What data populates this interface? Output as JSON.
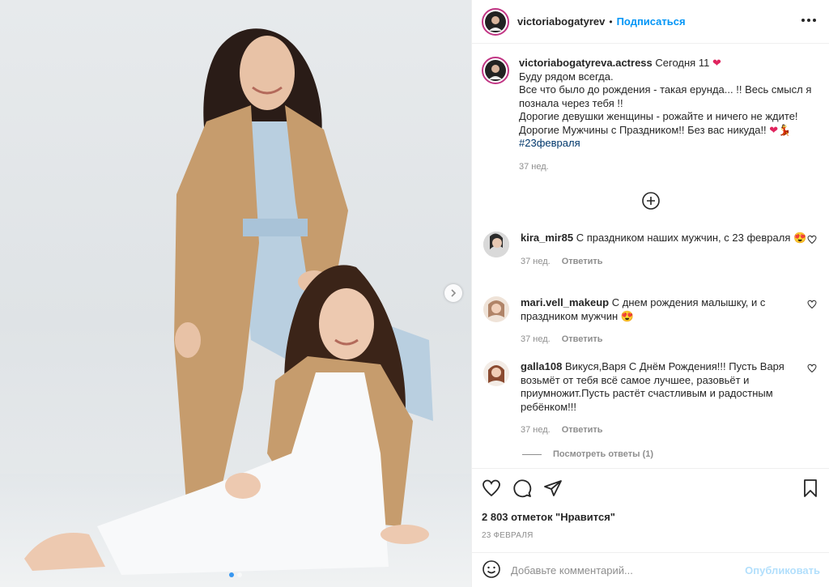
{
  "header": {
    "username": "victoriabogatyrev",
    "separator": "•",
    "follow_label": "Подписаться"
  },
  "caption": {
    "username": "victoriabogatyreva.actress",
    "intro": "Сегодня 11",
    "lines": [
      "Буду рядом всегда.",
      "Все что было до рождения - такая ерунда... !! Весь смысл я познала через тебя !!",
      "Дорогие девушки женщины - рожайте и ничего не ждите!",
      "Дорогие Мужчины с Праздником!! Без вас никуда!!"
    ],
    "hashtag": "#23февраля",
    "time": "37 нед."
  },
  "comments": [
    {
      "username": "kira_mir85",
      "text": "С праздником наших мужчин, с 23 февраля 😍",
      "time": "37 нед.",
      "reply_label": "Ответить"
    },
    {
      "username": "mari.vell_makeup",
      "text": "С днем рождения малышку, и с праздником мужчин 😍",
      "time": "37 нед.",
      "reply_label": "Ответить"
    },
    {
      "username": "galla108",
      "text": "Викуся,Варя С Днём Рождения!!! Пусть Варя возьмёт от тебя всё самое лучшее, разовьёт и приумножит.Пусть растёт счастливым и радостным ребёнком!!!",
      "time": "37 нед.",
      "reply_label": "Ответить"
    }
  ],
  "view_replies_label": "Посмотреть ответы (1)",
  "likes": "2 803 отметок \"Нравится\"",
  "date": "23 ФЕВРАЛЯ",
  "add_comment": {
    "placeholder": "Добавьте комментарий...",
    "publish_label": "Опубликовать"
  },
  "colors": {
    "accent": "#0095f6",
    "publish_disabled": "#b2dffc",
    "heart": "#e0245e",
    "muted": "#8e8e8e"
  },
  "icons": [
    "more-icon",
    "heart-icon",
    "comment-icon",
    "share-icon",
    "bookmark-icon",
    "emoji-icon",
    "plus-circle-icon",
    "chevron-right-icon"
  ]
}
